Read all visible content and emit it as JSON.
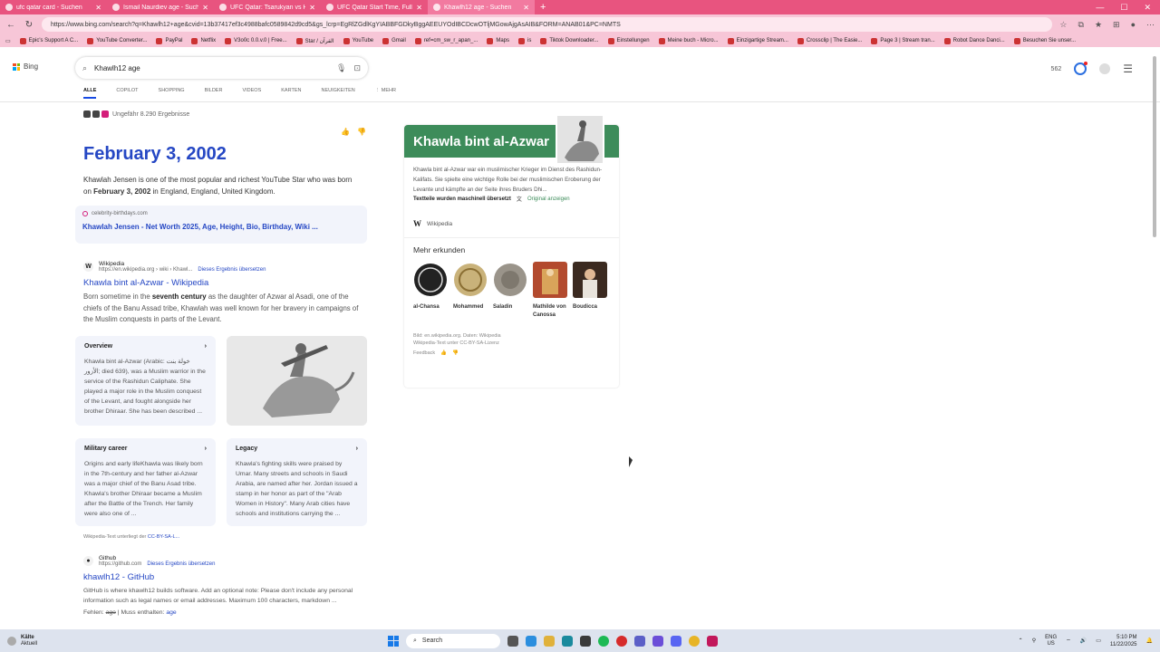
{
  "browser": {
    "tabs": [
      {
        "title": "ufc qatar card - Suchen",
        "active": false
      },
      {
        "title": "Ismail Naurdiev age - Suchen",
        "active": false
      },
      {
        "title": "UFC Qatar: Tsarukyan vs Hooker |",
        "active": false
      },
      {
        "title": "UFC Qatar Start Time, Full Fight C",
        "active": false
      },
      {
        "title": "Khawlh12 age - Suchen",
        "active": true
      }
    ],
    "url": "https://www.bing.com/search?q=Khawlh12+age&cvid=13b37417ef3c4988bafc0589842d9cd5&gs_lcrp=EgRlZGdlKgYIABBFGDkyBggAEEUYOdIBCDcwOTljMGowAjgAsAIB&FORM=ANAB01&PC=NMTS",
    "bookmarks": [
      "Epic's Support A C...",
      "YouTube Converter...",
      "PayPal",
      "Netflix",
      "V3o0c 0.0.v.0 | Free...",
      "Star / القرآن",
      "YouTube",
      "Gmail",
      "ref=cm_sw_r_apan_...",
      "Maps",
      "is",
      "Tiktok Downloader...",
      "Einstellungen",
      "Meine buch - Micro...",
      "Einzigartige Stream...",
      "Crossclip | The Easie...",
      "Page 3 | Stream tran...",
      "Robot Dance Danci...",
      "Besuchen Sie unser..."
    ]
  },
  "bing": {
    "logo": "Bing",
    "query": "Khawlh12 age",
    "points": "562",
    "scopes": [
      "ALLE",
      "COPILOT",
      "SHOPPING",
      "BILDER",
      "VIDEOS",
      "KARTEN",
      "NEUIGKEITEN",
      "⋮ MEHR"
    ],
    "result_stats": "Ungefähr 8.290 Ergebnisse"
  },
  "answer": {
    "date": "February 3, 2002",
    "text_before": "Khawlah Jensen is one of the most popular and richest YouTube Star who was born on ",
    "text_bold": "February 3, 2002",
    "text_after": " in England, England, United Kingdom.",
    "source_domain": "celebrity-birthdays.com",
    "source_title": "Khawlah Jensen - Net Worth 2025, Age, Height, Bio, Birthday, Wiki ..."
  },
  "results": [
    {
      "site": "Wikipedia",
      "url": "https://en.wikipedia.org › wiki › Khawl...",
      "translate": "Dieses Ergebnis übersetzen",
      "title": "Khawla bint al-Azwar - Wikipedia",
      "snippet_a": "Born sometime in the ",
      "snippet_b": "seventh century",
      "snippet_c": " as the daughter of Azwar al Asadi, one of the chiefs of the Banu Assad tribe, Khawlah was well known for her bravery in campaigns of the Muslim conquests in parts of the Levant."
    },
    {
      "site": "Github",
      "url": "https://github.com",
      "translate": "Dieses Ergebnis übersetzen",
      "title": "khawlh12 - GitHub",
      "snippet": "GitHub is where khawlh12 builds software. Add an optional note: Please don't include any personal information such as legal names or email addresses. Maximum 100 characters, markdown ...",
      "missing_label": "Fehlen: ",
      "missing_strike": "age",
      "missing_mid": " | Muss enthalten: ",
      "missing_link": "age"
    }
  ],
  "cards": {
    "overview": {
      "title": "Overview",
      "text": "Khawla bint al-Azwar (Arabic: خولة بنت الأزور; died 639), was a Muslim warrior in the service of the Rashidun Caliphate. She played a major role in the Muslim conquest of the Levant, and fought alongside her brother Dhiraar. She has been described ..."
    },
    "military": {
      "title": "Military career",
      "text": "Origins and early lifeKhawla was likely born in the 7th-century and her father al-Azwar was a major chief of the Banu Asad tribe. Khawla's brother Dhiraar became a Muslim after the Battle of the Trench. Her family were also one of ..."
    },
    "legacy": {
      "title": "Legacy",
      "text": "Khawla's fighting skills were praised by Umar. Many streets and schools in Saudi Arabia, are named after her. Jordan issued a stamp in her honor as part of the \"Arab Women in History\". Many Arab cities have schools and institutions carrying the ..."
    }
  },
  "license_note_prefix": "Wikipedia-Text unterliegt der ",
  "license_note_link": "CC-BY-SA-L...",
  "knowledge_panel": {
    "title": "Khawla bint al-Azwar",
    "description": "Khawla bint al-Azwar war ein muslimischer Krieger im Dienst des Rashidun-Kalifats. Sie spielte eine wichtige Rolle bei der muslimischen Eroberung der Levante und kämpfte an der Seite ihres Bruders Dhi...",
    "machine_translated": "Textteile wurden maschinell übersetzt",
    "original_link": "Original anzeigen",
    "wiki_label": "Wikipedia",
    "more_title": "Mehr erkunden",
    "related": [
      "al-Chansa",
      "Mohammed",
      "Saladin",
      "Mathilde von Canossa",
      "Boudicca"
    ],
    "footer_1": "Bild: en.wikipedia.org. Daten: Wikipedia",
    "footer_2": "Wikipedia-Text unter CC-BY-SA-Lizenz",
    "feedback": "Feedback",
    "header_color": "#3d8c5a"
  },
  "taskbar": {
    "weather_1": "Kälte",
    "weather_2": "Aktuell",
    "search": "Search",
    "lang_1": "ENG",
    "lang_2": "US",
    "time": "5:10 PM",
    "date": "11/22/2025"
  }
}
